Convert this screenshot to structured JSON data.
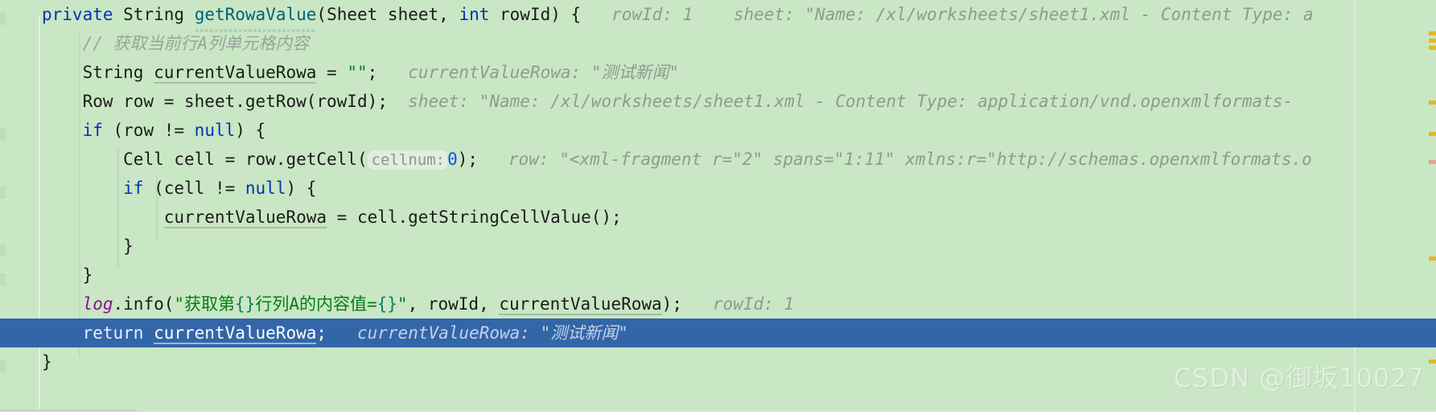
{
  "editor": {
    "language": "Java",
    "background_color": "#c9e7c4",
    "selected_line_color": "#3366a8",
    "keyword_color": "#0033b3",
    "string_color": "#067d17",
    "comment_color": "#9aa39a",
    "debug_hint_color": "#8f9a8f",
    "field_color": "#871094"
  },
  "code": {
    "line1": {
      "kw_private": "private",
      "type_string": "String",
      "method_name": "getRowaValue",
      "paren_open": "(",
      "param_type_sheet": "Sheet sheet, ",
      "kw_int": "int",
      "param_rowid": " rowId) {",
      "hint_rowid": "rowId: 1",
      "hint_sheet": "sheet: \"Name: /xl/worksheets/sheet1.xml - Content Type: a"
    },
    "line2": {
      "comment": "// 获取当前行A列单元格内容"
    },
    "line3": {
      "type_string": "String",
      "var_name": "currentValueRowa",
      "assign": " = ",
      "empty_string": "\"\"",
      "semi": ";",
      "hint_name": "currentValueRowa:",
      "hint_value": "\"测试新闻\""
    },
    "line4": {
      "code": "Row row = sheet.getRow(rowId);",
      "hint_name": "sheet:",
      "hint_value": "\"Name: /xl/worksheets/sheet1.xml - Content Type: application/vnd.openxmlformats-"
    },
    "line5": {
      "kw_if": "if",
      "cond_a": " (row != ",
      "kw_null": "null",
      "cond_b": ") {"
    },
    "line6": {
      "code_a": "Cell cell = row.getCell(",
      "inlay": "cellnum:",
      "num": "0",
      "code_b": ");",
      "hint_name": "row:",
      "hint_value": "\"<xml-fragment r=\"2\" spans=\"1:11\" xmlns:r=\"http://schemas.openxmlformats.o"
    },
    "line7": {
      "kw_if": "if",
      "cond_a": " (cell != ",
      "kw_null": "null",
      "cond_b": ") {"
    },
    "line8": {
      "var_name": "currentValueRowa",
      "code": " = cell.getStringCellValue();"
    },
    "line9": {
      "code": "}"
    },
    "line10": {
      "code": "}"
    },
    "line11": {
      "field_log": "log",
      "code_a": ".info(",
      "str_quote_open": "\"",
      "str_part1": "获取第",
      "brace1": "{}",
      "str_part2": "行列A的内容值=",
      "brace2": "{}",
      "str_quote_close": "\"",
      "code_b": ", rowId, ",
      "var_name": "currentValueRowa",
      "code_c": ");",
      "hint_name": "rowId: 1"
    },
    "line12": {
      "kw_return": "return",
      "var_name": "currentValueRowa",
      "semi": ";",
      "hint_name": "currentValueRowa:",
      "hint_value": "\"测试新闻\""
    },
    "line13": {
      "code": "}"
    }
  },
  "watermark": {
    "text": "CSDN @御坂10027"
  }
}
